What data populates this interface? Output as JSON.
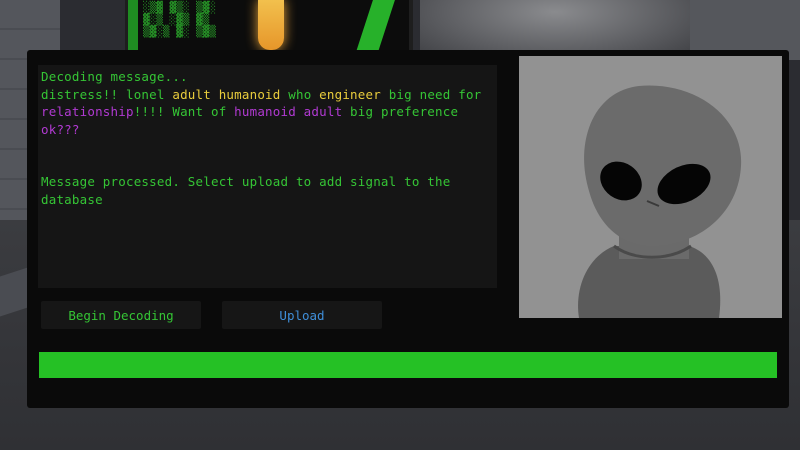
{
  "message_panel": {
    "line1": "Decoding message...",
    "decoded": [
      {
        "t": "distress!! lonel ",
        "c": "green"
      },
      {
        "t": "adult humanoid",
        "c": "yellow"
      },
      {
        "t": " who ",
        "c": "green"
      },
      {
        "t": "engineer",
        "c": "yellow"
      },
      {
        "t": " big need for ",
        "c": "green"
      },
      {
        "t": "relationship",
        "c": "purple"
      },
      {
        "t": "!!!! Want of ",
        "c": "green"
      },
      {
        "t": "humanoid adult",
        "c": "purple"
      },
      {
        "t": " big preference ",
        "c": "green"
      },
      {
        "t": "ok???",
        "c": "purple"
      }
    ],
    "status": "Message processed. Select upload to add signal to the database"
  },
  "buttons": {
    "decode_label": "Begin Decoding",
    "upload_label": "Upload"
  },
  "progress": {
    "fraction": 1.0
  },
  "portrait": {
    "icon": "alien-face-icon"
  },
  "colors": {
    "green_text": "#35c535",
    "yellow_text": "#e9cd3c",
    "purple_text": "#b13ad2",
    "upload_text": "#3f8ed8",
    "progress": "#25c125"
  }
}
